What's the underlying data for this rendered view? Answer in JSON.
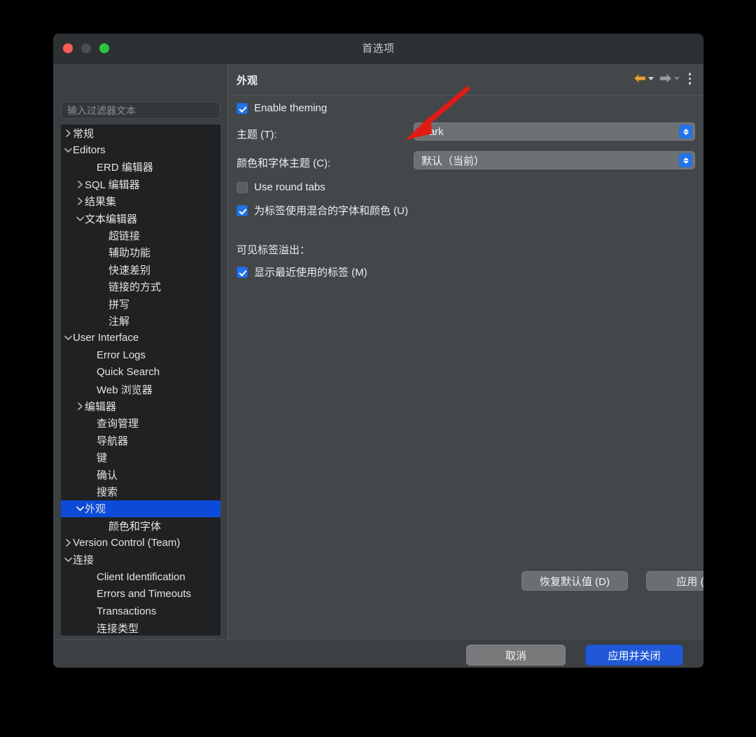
{
  "window": {
    "title": "首选项",
    "traffic_lights": [
      "close-red",
      "minimize-gray",
      "zoom-green"
    ]
  },
  "sidebar": {
    "filter": {
      "placeholder": "输入过滤器文本",
      "value": ""
    },
    "items": [
      {
        "label": "常规",
        "depth": 0,
        "twisty": "collapsed",
        "selected": false
      },
      {
        "label": "Editors",
        "depth": 0,
        "twisty": "expanded",
        "selected": false
      },
      {
        "label": "ERD 编辑器",
        "depth": 2,
        "twisty": "none",
        "selected": false
      },
      {
        "label": "SQL 编辑器",
        "depth": 1,
        "twisty": "collapsed",
        "selected": false
      },
      {
        "label": "结果集",
        "depth": 1,
        "twisty": "collapsed",
        "selected": false
      },
      {
        "label": "文本编辑器",
        "depth": 1,
        "twisty": "expanded",
        "selected": false
      },
      {
        "label": "超链接",
        "depth": 3,
        "twisty": "none",
        "selected": false
      },
      {
        "label": "辅助功能",
        "depth": 3,
        "twisty": "none",
        "selected": false
      },
      {
        "label": "快速差别",
        "depth": 3,
        "twisty": "none",
        "selected": false
      },
      {
        "label": "链接的方式",
        "depth": 3,
        "twisty": "none",
        "selected": false
      },
      {
        "label": "拼写",
        "depth": 3,
        "twisty": "none",
        "selected": false
      },
      {
        "label": "注解",
        "depth": 3,
        "twisty": "none",
        "selected": false
      },
      {
        "label": "User Interface",
        "depth": 0,
        "twisty": "expanded",
        "selected": false
      },
      {
        "label": "Error Logs",
        "depth": 2,
        "twisty": "none",
        "selected": false
      },
      {
        "label": "Quick Search",
        "depth": 2,
        "twisty": "none",
        "selected": false
      },
      {
        "label": "Web 浏览器",
        "depth": 2,
        "twisty": "none",
        "selected": false
      },
      {
        "label": "编辑器",
        "depth": 1,
        "twisty": "collapsed",
        "selected": false
      },
      {
        "label": "查询管理",
        "depth": 2,
        "twisty": "none",
        "selected": false
      },
      {
        "label": "导航器",
        "depth": 2,
        "twisty": "none",
        "selected": false
      },
      {
        "label": "键",
        "depth": 2,
        "twisty": "none",
        "selected": false
      },
      {
        "label": "确认",
        "depth": 2,
        "twisty": "none",
        "selected": false
      },
      {
        "label": "搜索",
        "depth": 2,
        "twisty": "none",
        "selected": false
      },
      {
        "label": "外观",
        "depth": 1,
        "twisty": "expanded",
        "selected": true
      },
      {
        "label": "颜色和字体",
        "depth": 3,
        "twisty": "none",
        "selected": false
      },
      {
        "label": "Version Control (Team)",
        "depth": 0,
        "twisty": "collapsed",
        "selected": false
      },
      {
        "label": "连接",
        "depth": 0,
        "twisty": "expanded",
        "selected": false
      },
      {
        "label": "Client Identification",
        "depth": 2,
        "twisty": "none",
        "selected": false
      },
      {
        "label": "Errors and Timeouts",
        "depth": 2,
        "twisty": "none",
        "selected": false
      },
      {
        "label": "Transactions",
        "depth": 2,
        "twisty": "none",
        "selected": false
      },
      {
        "label": "连接类型",
        "depth": 2,
        "twisty": "none",
        "selected": false
      }
    ]
  },
  "panel": {
    "title": "外观",
    "toolbar": {
      "back_icon": "arrow-left-icon",
      "back_enabled": true,
      "forward_icon": "arrow-right-icon",
      "forward_enabled": false,
      "menu_icon": "kebab-menu-icon"
    },
    "enable_theming": {
      "label": "Enable theming",
      "checked": true
    },
    "theme": {
      "label": "主题 (T):",
      "value": "Dark"
    },
    "color_font_theme": {
      "label": "颜色和字体主题 (C):",
      "value": "默认（当前）"
    },
    "round_tabs": {
      "label": "Use round tabs",
      "checked": false
    },
    "mixed_fonts": {
      "label": "为标签使用混合的字体和颜色 (U)",
      "checked": true
    },
    "overflow_group": {
      "title": "可见标签溢出：",
      "recent_tabs": {
        "label": "显示最近使用的标签 (M)",
        "checked": true
      }
    },
    "restore_defaults_label": "恢复默认值 (D)",
    "apply_label": "应用 (A)"
  },
  "footer": {
    "cancel_label": "取消",
    "apply_close_label": "应用并关闭"
  },
  "annotation": {
    "arrow_color": "#e01b13",
    "points_to": "theme-combobox"
  },
  "colors": {
    "accent_blue": "#2272e8",
    "primary_button": "#2058d8",
    "selection_blue": "#0b4bd8",
    "window_bg": "#3c4043",
    "panel_bg": "#43474a",
    "tree_bg": "#1f2123",
    "titlebar_bg": "#2e3133",
    "back_arrow": "#e8a23c"
  }
}
